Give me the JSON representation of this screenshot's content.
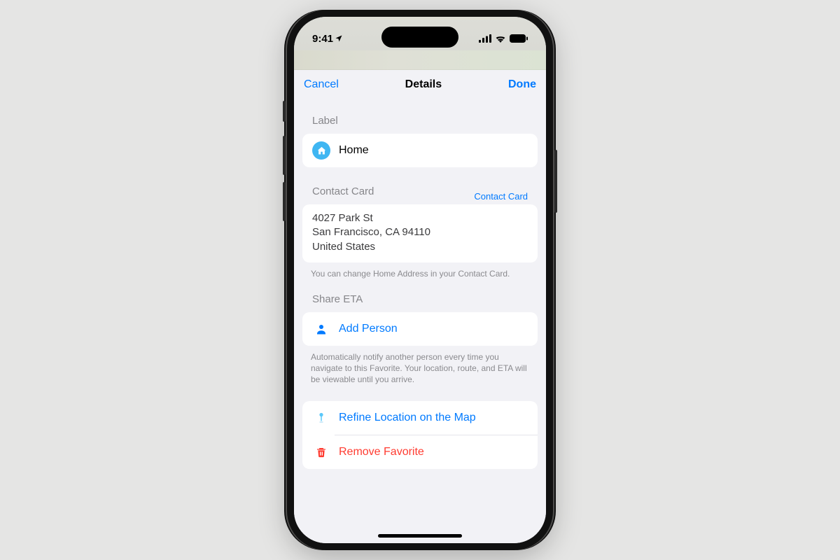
{
  "status": {
    "time": "9:41"
  },
  "header": {
    "cancel": "Cancel",
    "title": "Details",
    "done": "Done"
  },
  "label_section": {
    "header": "Label",
    "value": "Home"
  },
  "contact_section": {
    "header": "Contact Card",
    "link": "Contact Card",
    "address_line1": "4027 Park St",
    "address_line2": "San Francisco, CA 94110",
    "address_line3": "United States",
    "footnote": "You can change Home Address in your Contact Card."
  },
  "share_section": {
    "header": "Share ETA",
    "add_person": "Add Person",
    "footnote": "Automatically notify another person every time you navigate to this Favorite. Your location, route, and ETA will be viewable until you arrive."
  },
  "actions": {
    "refine": "Refine Location on the Map",
    "remove": "Remove Favorite"
  }
}
